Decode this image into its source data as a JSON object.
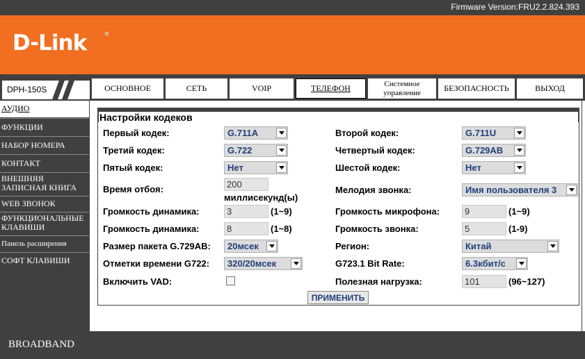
{
  "header": {
    "firmware": "Firmware Version:FRU2.2.824.393",
    "logo_text": "D-Link"
  },
  "model": "DPH-150S",
  "tabs": [
    {
      "label": "ОСНОВНОЕ"
    },
    {
      "label": "СЕТЬ"
    },
    {
      "label": "VOIP"
    },
    {
      "label": "ТЕЛЕФОН",
      "active": true
    },
    {
      "label_line1": "Системное",
      "label_line2": "управление"
    },
    {
      "label": "БЕЗОПАСНОСТЬ"
    },
    {
      "label": "ВЫХОД"
    }
  ],
  "sidebar": {
    "items": [
      {
        "label": "АУДИО",
        "active": true
      },
      {
        "label": "ФУНКЦИИ"
      },
      {
        "label": "НАБОР НОМЕРА"
      },
      {
        "label": "КОНТАКТ"
      },
      {
        "label_line1": "ВНЕШНЯЯ",
        "label_line2": "ЗАПИСНАЯ КНИГА"
      },
      {
        "label": "WEB ЗВОНОК"
      },
      {
        "label_line1": "ФУНКЦИОНАЛЬНЫЕ",
        "label_line2": "КЛАВИШИ"
      },
      {
        "label": "Панель расширения"
      },
      {
        "label": "СОФТ КЛАВИШИ"
      }
    ]
  },
  "section": {
    "title": "Настройки кодеков"
  },
  "fields": {
    "codec1": {
      "label": "Первый кодек:",
      "value": "G.711A"
    },
    "codec2": {
      "label": "Второй кодек:",
      "value": "G.711U"
    },
    "codec3": {
      "label": "Третий кодек:",
      "value": "G.722"
    },
    "codec4": {
      "label": "Четвертый кодек:",
      "value": "G.729AB"
    },
    "codec5": {
      "label": "Пятый кодек:",
      "value": "Нет"
    },
    "codec6": {
      "label": "Шестой кодек:",
      "value": "Нет"
    },
    "hangup": {
      "label": "Время отбоя:",
      "value": "200",
      "unit": "миллисекунд(ы)"
    },
    "ringtone": {
      "label": "Мелодия звонка:",
      "value": "Имя пользователя 3"
    },
    "speaker_vol1": {
      "label": "Громкость динамика:",
      "value": "3",
      "range": "(1~9)"
    },
    "mic_vol": {
      "label": "Громкость микрофона:",
      "value": "9",
      "range": "(1~9)"
    },
    "speaker_vol2": {
      "label": "Громкость динамика:",
      "value": "8",
      "range": "(1~8)"
    },
    "ring_vol": {
      "label": "Громкость звонка:",
      "value": "5",
      "range": "(1-9)"
    },
    "packet_size": {
      "label": "Размер пакета G.729AB:",
      "value": "20мсек"
    },
    "region": {
      "label": "Регион:",
      "value": "Китай"
    },
    "g722_ts": {
      "label": "Отметки времени G722:",
      "value": "320/20мсек"
    },
    "g7231_rate": {
      "label": "G723.1 Bit Rate:",
      "value": "6.3кбит/с"
    },
    "vad": {
      "label": "Включить VAD:",
      "checked": false
    },
    "payload": {
      "label": "Полезная нагрузка:",
      "value": "101",
      "range": "(96~127)"
    }
  },
  "apply_label": "ПРИМЕНИТЬ",
  "footer": "BROADBAND",
  "colors": {
    "orange": "#f26f21",
    "dark": "#404040",
    "select_text": "#1f3f7a"
  }
}
